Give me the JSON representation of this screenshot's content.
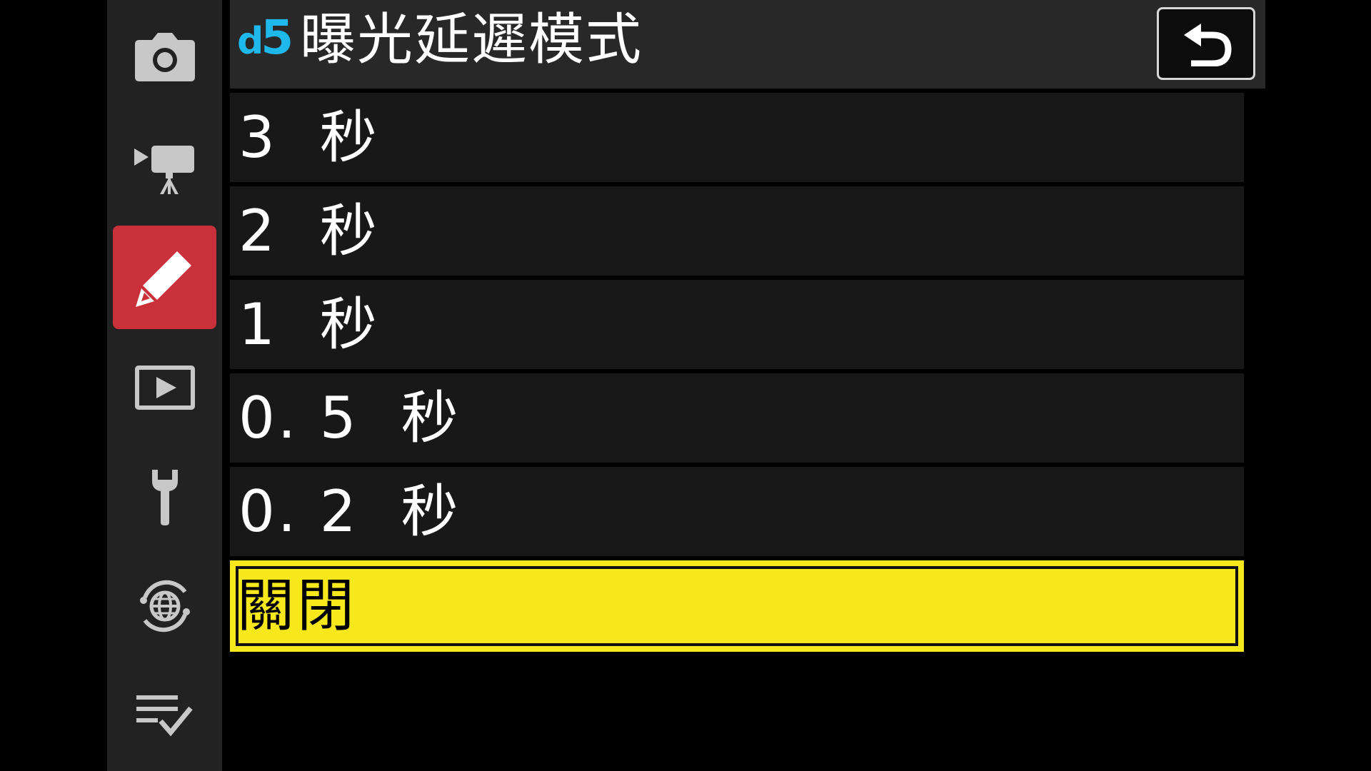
{
  "sidebar": {
    "items": [
      {
        "name": "photo-shooting-menu",
        "icon": "camera-icon"
      },
      {
        "name": "movie-recording-menu",
        "icon": "movie-camera-icon"
      },
      {
        "name": "custom-settings-menu",
        "icon": "pencil-icon",
        "active": true
      },
      {
        "name": "playback-menu",
        "icon": "playback-icon"
      },
      {
        "name": "setup-menu",
        "icon": "wrench-icon"
      },
      {
        "name": "network-menu",
        "icon": "network-globe-icon"
      },
      {
        "name": "my-menu",
        "icon": "checklist-icon"
      }
    ]
  },
  "header": {
    "code_letter": "d",
    "code_number": "5",
    "title": "曝光延遲模式",
    "back_icon": "return-arrow-icon"
  },
  "options": [
    {
      "label": "3  秒",
      "selected": false
    },
    {
      "label": "2  秒",
      "selected": false
    },
    {
      "label": "1  秒",
      "selected": false
    },
    {
      "label": "0. 5  秒",
      "selected": false
    },
    {
      "label": "0. 2  秒",
      "selected": false
    },
    {
      "label": "關閉",
      "selected": true
    }
  ],
  "colors": {
    "accent_code": "#1fb8ea",
    "active_tab": "#c9303a",
    "selection": "#f7e81e",
    "row_background": "#181818",
    "sidebar_background": "#222222"
  }
}
